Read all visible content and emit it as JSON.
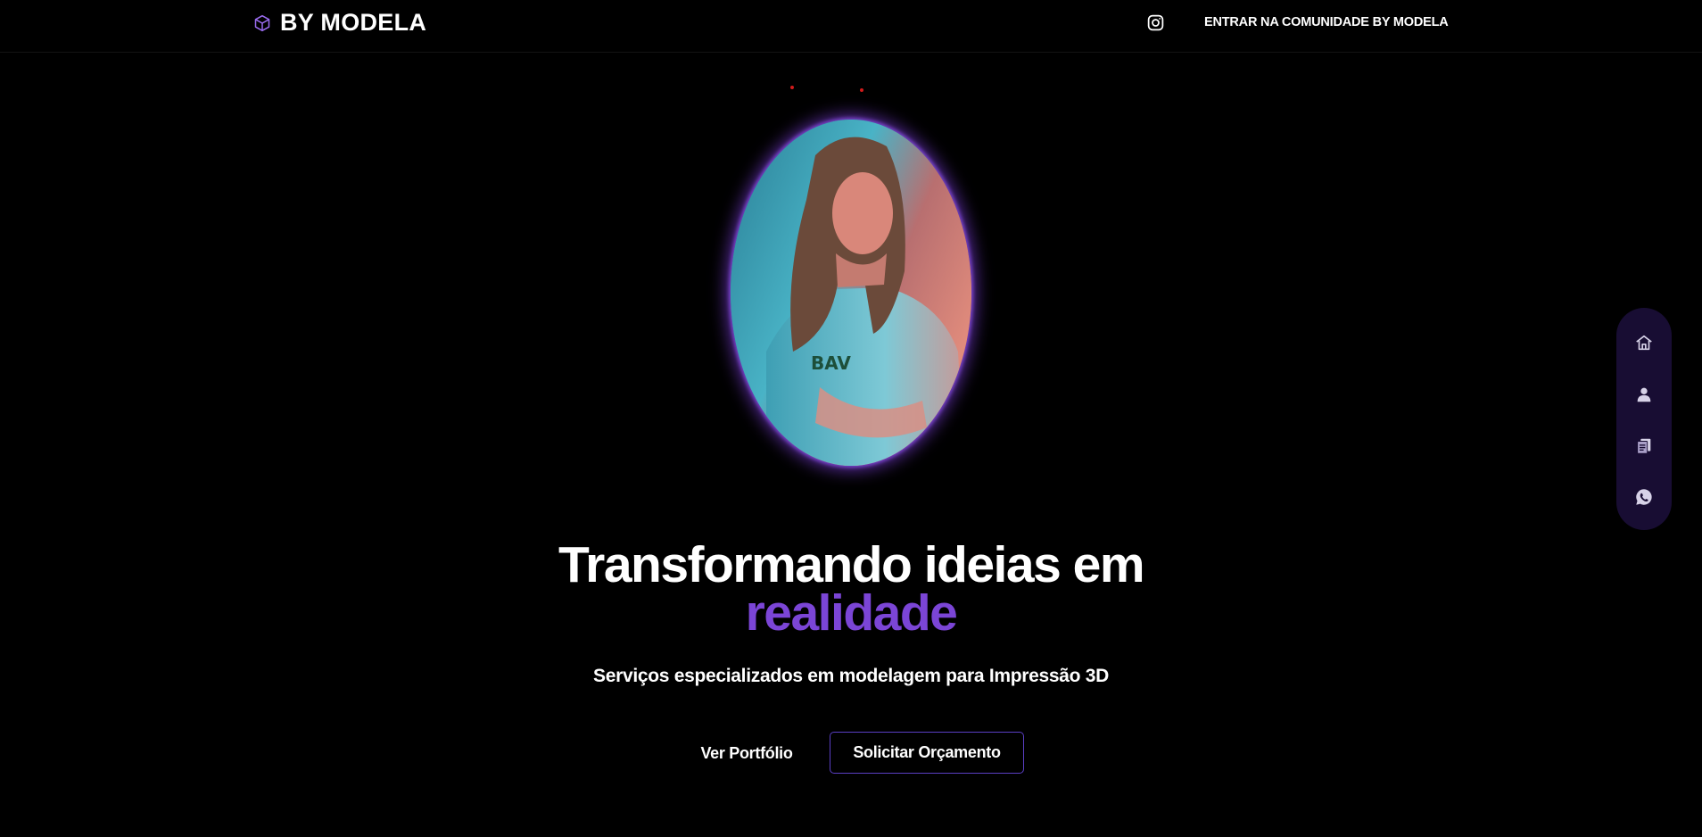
{
  "header": {
    "brand_name": "BY MODELA",
    "brand_icon": "cube-icon",
    "instagram_icon": "instagram-icon",
    "community_link": "ENTRAR NA COMUNIDADE BY MODELA"
  },
  "hero": {
    "portrait_image": "portrait-photo",
    "title_line1": "Transformando ideias em",
    "title_accent": "realidade",
    "subtitle": "Serviços especializados em modelagem para Impressão 3D",
    "portfolio_button": "Ver Portfólio",
    "quote_button": "Solicitar Orçamento"
  },
  "side_nav": {
    "items": [
      {
        "icon": "home-icon"
      },
      {
        "icon": "user-icon"
      },
      {
        "icon": "documents-icon"
      },
      {
        "icon": "whatsapp-icon"
      }
    ]
  },
  "colors": {
    "background": "#000000",
    "accent": "#7b45d6",
    "button_border": "#5a3fc4",
    "side_nav_bg": "#180d33",
    "dot": "#d21b1b"
  }
}
